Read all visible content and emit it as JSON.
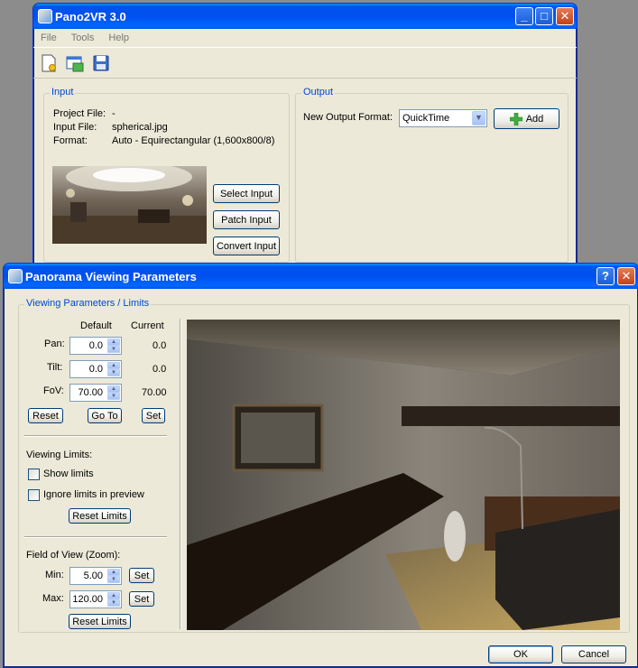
{
  "main_window": {
    "title": "Pano2VR 3.0",
    "menu": [
      "File",
      "Tools",
      "Help"
    ],
    "input_group": {
      "label": "Input",
      "project_file_label": "Project File:",
      "project_file_value": "-",
      "input_file_label": "Input File:",
      "input_file_value": "spherical.jpg",
      "format_label": "Format:",
      "format_value": "Auto - Equirectangular (1,600x800/8)",
      "select_input": "Select Input",
      "patch_input": "Patch Input",
      "convert_input": "Convert Input"
    },
    "output_group": {
      "label": "Output",
      "new_output_label": "New Output Format:",
      "format_selected": "QuickTime",
      "add_button": "Add"
    }
  },
  "dialog": {
    "title": "Panorama Viewing Parameters",
    "group_label": "Viewing Parameters / Limits",
    "col_default": "Default",
    "col_current": "Current",
    "pan_label": "Pan:",
    "pan_default": "0.0",
    "pan_current": "0.0",
    "tilt_label": "Tilt:",
    "tilt_default": "0.0",
    "tilt_current": "0.0",
    "fov_label": "FoV:",
    "fov_default": "70.00",
    "fov_current": "70.00",
    "reset": "Reset",
    "goto": "Go To",
    "set": "Set",
    "viewing_limits_label": "Viewing Limits:",
    "show_limits": "Show limits",
    "ignore_limits": "Ignore limits in preview",
    "reset_limits": "Reset Limits",
    "fov_zoom_label": "Field of View (Zoom):",
    "min_label": "Min:",
    "min_value": "5.00",
    "max_label": "Max:",
    "max_value": "120.00",
    "ok": "OK",
    "cancel": "Cancel"
  },
  "colors": {
    "accent": "#0046d5",
    "titlebar": "#0054e3",
    "window_bg": "#ece9d8"
  }
}
